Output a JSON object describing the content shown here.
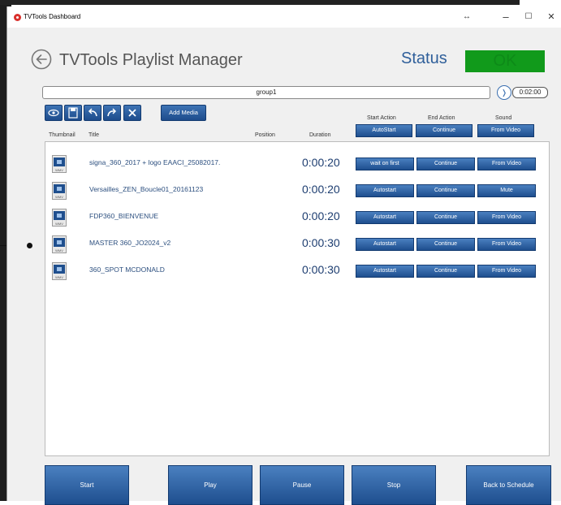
{
  "window": {
    "title": "TVTools Dashboard"
  },
  "window_controls": {
    "extra": "↔",
    "minimize": "–",
    "maximize": "☐",
    "close": "✕"
  },
  "header": {
    "title": "TVTools Playlist Manager",
    "status_label": "Status",
    "status_value": "OK",
    "status_color": "#119a1b"
  },
  "group": {
    "name": "group1",
    "total_duration": "0:02:00",
    "next_symbol": "❭"
  },
  "toolbar": {
    "add_media_label": "Add Media"
  },
  "columns": {
    "thumbnail": "Thumbnail",
    "title": "Title",
    "position": "Position",
    "duration": "Duration",
    "start_action": "Start Action",
    "end_action": "End Action",
    "sound": "Sound"
  },
  "column_defaults": {
    "start_action": "AutoStart",
    "end_action": "Continue",
    "sound": "From Video"
  },
  "thumb_label": "WMV",
  "items": [
    {
      "title": "signa_360_2017 + logo EAACI_25082017.",
      "duration": "0:00:20",
      "start_action": "wait on first",
      "end_action": "Continue",
      "sound": "From Video"
    },
    {
      "title": "Versailles_ZEN_Boucle01_20161123",
      "duration": "0:00:20",
      "start_action": "Autostart",
      "end_action": "Continue",
      "sound": "Mute"
    },
    {
      "title": "FDP360_BIENVENUE",
      "duration": "0:00:20",
      "start_action": "Autostart",
      "end_action": "Continue",
      "sound": "From Video"
    },
    {
      "title": "MASTER 360_JO2024_v2",
      "duration": "0:00:30",
      "start_action": "Autostart",
      "end_action": "Continue",
      "sound": "From Video"
    },
    {
      "title": "360_SPOT MCDONALD",
      "duration": "0:00:30",
      "start_action": "Autostart",
      "end_action": "Continue",
      "sound": "From Video"
    }
  ],
  "bottom": {
    "start": "Start",
    "play": "Play",
    "pause": "Pause",
    "stop": "Stop",
    "back": "Back to Schedule"
  },
  "colors": {
    "accent": "#2f5f9a",
    "button": "#2a5ea0"
  }
}
